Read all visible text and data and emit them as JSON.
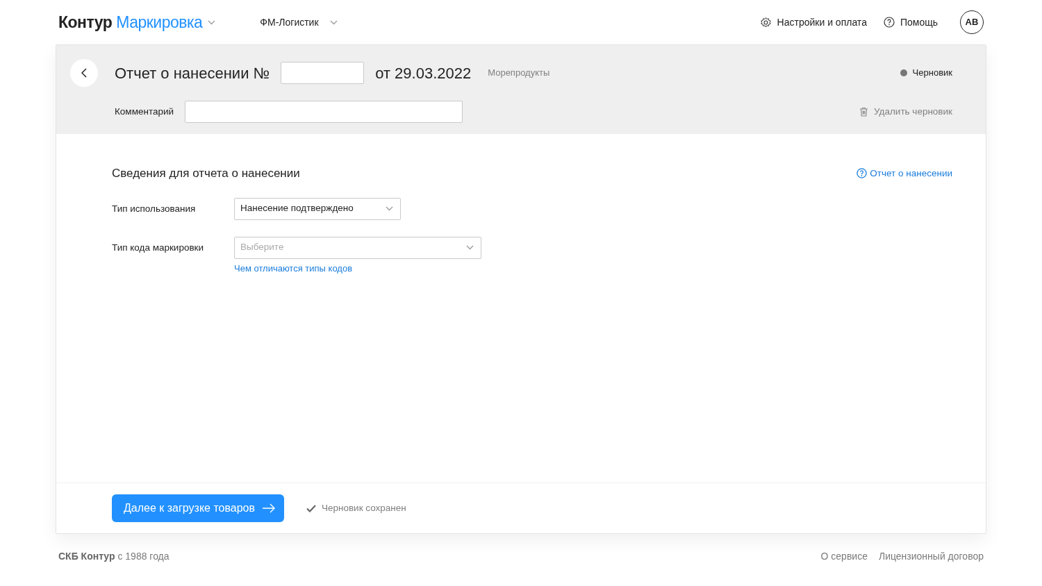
{
  "header": {
    "brand_first": "Контур",
    "brand_second": "Маркировка",
    "organization": "ФМ-Логистик",
    "settings": "Настройки и оплата",
    "help": "Помощь",
    "avatar": "АВ"
  },
  "document": {
    "title": "Отчет о нанесении №",
    "date": "от 29.03.2022",
    "category": "Морепродукты",
    "status": "Черновик",
    "comment_label": "Комментарий",
    "delete": "Удалить черновик"
  },
  "section": {
    "title": "Сведения для отчета о нанесении",
    "help_link": "Отчет о нанесении",
    "fields": [
      {
        "label": "Тип использования",
        "value": "Нанесение подтверждено"
      },
      {
        "label": "Тип кода маркировки",
        "placeholder": "Выберите",
        "hint_link": "Чем отличаются типы кодов"
      }
    ]
  },
  "actions": {
    "next_button": "Далее к загрузке товаров",
    "saved": "Черновик сохранен"
  },
  "footer": {
    "copyright": "**СКБ Контур** с 1988 года",
    "links": [
      "О сервисе",
      "Лицензионный договор"
    ]
  }
}
